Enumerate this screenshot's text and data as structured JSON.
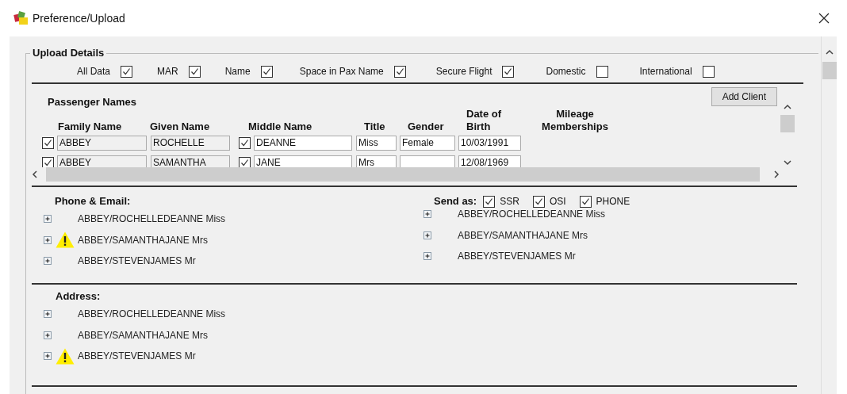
{
  "window": {
    "title": "Preference/Upload"
  },
  "upload_details": {
    "title": "Upload Details",
    "options": [
      {
        "label": "All Data",
        "checked": true
      },
      {
        "label": "MAR",
        "checked": true
      },
      {
        "label": "Name",
        "checked": true
      },
      {
        "label": "Space in Pax Name",
        "checked": true
      },
      {
        "label": "Secure Flight",
        "checked": true
      },
      {
        "label": "Domestic",
        "checked": false
      },
      {
        "label": "International",
        "checked": false
      }
    ]
  },
  "passengers": {
    "title": "Passenger Names",
    "add_button": "Add Client",
    "columns": [
      "Family Name",
      "Given Name",
      "Middle Name",
      "Title",
      "Gender",
      "Date of Birth",
      "Mileage Memberships"
    ],
    "rows": [
      {
        "checked": true,
        "family_name": "ABBEY",
        "given_name": "ROCHELLE",
        "middle_checked": true,
        "middle_name": "DEANNE",
        "title": "Miss",
        "gender": "Female",
        "date_of_birth": "10/03/1991"
      },
      {
        "checked": true,
        "family_name": "ABBEY",
        "given_name": "SAMANTHA",
        "middle_checked": true,
        "middle_name": "JANE",
        "title": "Mrs",
        "date_of_birth": "12/08/1969"
      }
    ]
  },
  "phone_email": {
    "title": "Phone & Email:",
    "items": [
      {
        "name": "ABBEY/ROCHELLEDEANNE Miss",
        "warning": false
      },
      {
        "name": "ABBEY/SAMANTHAJANE Mrs",
        "warning": true
      },
      {
        "name": "ABBEY/STEVENJAMES Mr",
        "warning": false
      }
    ],
    "send_as": {
      "label": "Send as:",
      "options": [
        {
          "label": "SSR",
          "checked": true
        },
        {
          "label": "OSI",
          "checked": true
        },
        {
          "label": "PHONE",
          "checked": true
        }
      ],
      "items": [
        {
          "name": "ABBEY/ROCHELLEDEANNE Miss"
        },
        {
          "name": "ABBEY/SAMANTHAJANE Mrs"
        },
        {
          "name": "ABBEY/STEVENJAMES Mr"
        }
      ]
    }
  },
  "address": {
    "title": "Address:",
    "items": [
      {
        "name": "ABBEY/ROCHELLEDEANNE Miss",
        "warning": false
      },
      {
        "name": "ABBEY/SAMANTHAJANE Mrs",
        "warning": false
      },
      {
        "name": "ABBEY/STEVENJAMES Mr",
        "warning": true
      }
    ]
  }
}
